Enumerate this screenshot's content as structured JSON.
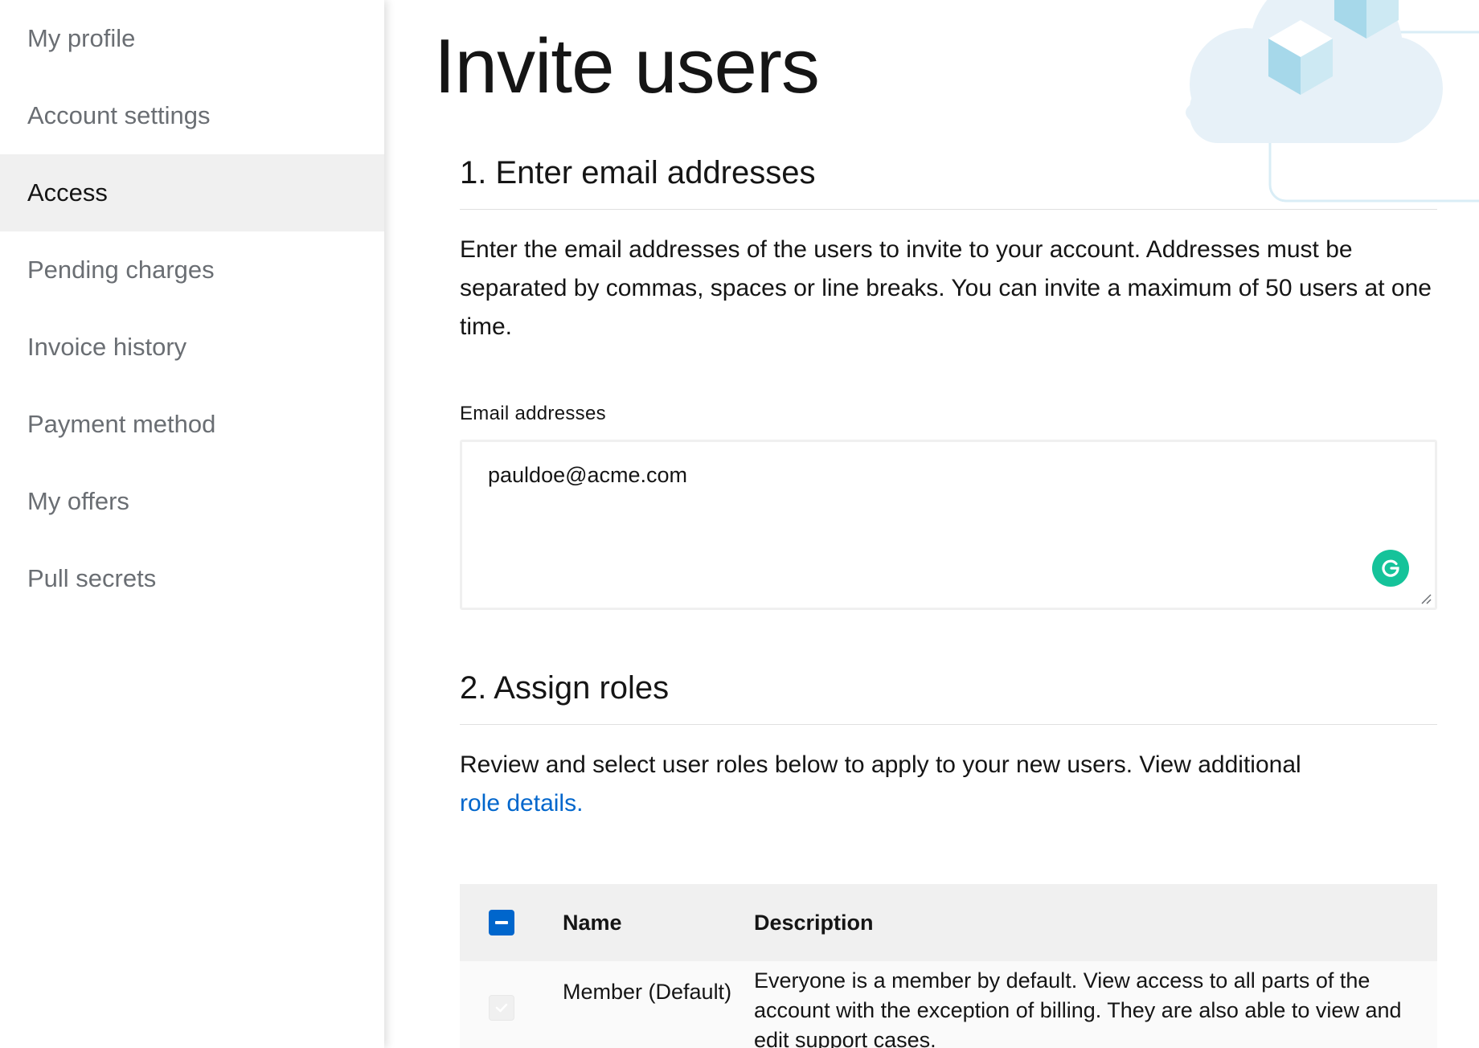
{
  "sidebar": {
    "items": [
      {
        "label": "My profile",
        "active": false
      },
      {
        "label": "Account settings",
        "active": false
      },
      {
        "label": "Access",
        "active": true
      },
      {
        "label": "Pending charges",
        "active": false
      },
      {
        "label": "Invoice history",
        "active": false
      },
      {
        "label": "Payment method",
        "active": false
      },
      {
        "label": "My offers",
        "active": false
      },
      {
        "label": "Pull secrets",
        "active": false
      }
    ]
  },
  "main": {
    "title": "Invite users",
    "section1": {
      "title": "1. Enter email addresses",
      "description": "Enter the email addresses of the users to invite to your account. Addresses must be separated by commas, spaces or line breaks. You can invite a maximum of 50 users at one time.",
      "field_label": "Email addresses",
      "field_value": "pauldoe@acme.com"
    },
    "section2": {
      "title": "2. Assign roles",
      "description": "Review and select user roles below to apply to your new users. View additional",
      "link_text": "role details."
    },
    "table": {
      "headers": {
        "name": "Name",
        "description": "Description"
      },
      "rows": [
        {
          "name": "Member (Default)",
          "description": "Everyone is a member by default. View access to all parts of the account with the exception of billing. They are also able to view and edit support cases."
        }
      ]
    }
  },
  "icons": {
    "grammarly": "grammarly-icon",
    "header_select": "minus-checkbox-icon",
    "row_select": "check-icon",
    "decoration": "cloud-cubes-illustration"
  },
  "colors": {
    "accent": "#0066cc",
    "grammarly": "#15c39a",
    "active_nav_bg": "#f0f0f0",
    "table_header_bg": "#f0f0f0",
    "decor_cloud": "#e7f1f8",
    "decor_cube": "#a6d8ea"
  }
}
